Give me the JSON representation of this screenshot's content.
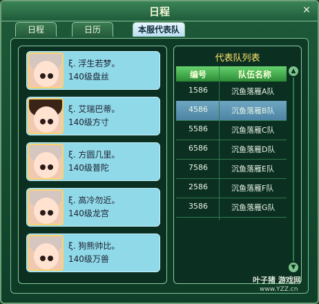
{
  "window": {
    "title": "日程",
    "close_icon": "close-icon"
  },
  "tabs": [
    {
      "label": "日程"
    },
    {
      "label": "日历"
    },
    {
      "label": "本服代表队"
    }
  ],
  "members": [
    {
      "name": "ξ. 浮生若梦。",
      "level": "140级盘丝",
      "avatar": "female-avatar"
    },
    {
      "name": "ξ. 艾瑞巴蒂。",
      "level": "140级方寸",
      "avatar": "male-avatar"
    },
    {
      "name": "ξ. 方圆几里。",
      "level": "140级普陀",
      "avatar": "female-avatar"
    },
    {
      "name": "ξ. 高冷勿近。",
      "level": "140级龙宫",
      "avatar": "female-avatar"
    },
    {
      "name": "ξ. 狗熊帅比。",
      "level": "140级万兽",
      "avatar": "female-avatar"
    }
  ],
  "team_list": {
    "title": "代表队列表",
    "headers": {
      "id": "编号",
      "team": "队伍名称"
    },
    "rows": [
      {
        "id": "1586",
        "team": "沉鱼落雁A队",
        "selected": false
      },
      {
        "id": "4586",
        "team": "沉鱼落雁B队",
        "selected": true
      },
      {
        "id": "5586",
        "team": "沉鱼落雁C队",
        "selected": false
      },
      {
        "id": "6586",
        "team": "沉鱼落雁D队",
        "selected": false
      },
      {
        "id": "7586",
        "team": "沉鱼落雁E队",
        "selected": false
      },
      {
        "id": "2586",
        "team": "沉鱼落雁F队",
        "selected": false
      },
      {
        "id": "3586",
        "team": "沉鱼落雁G队",
        "selected": false
      }
    ]
  },
  "watermark": {
    "text": "叶子猪 游戏网",
    "url": "www.YZZ.cn"
  }
}
